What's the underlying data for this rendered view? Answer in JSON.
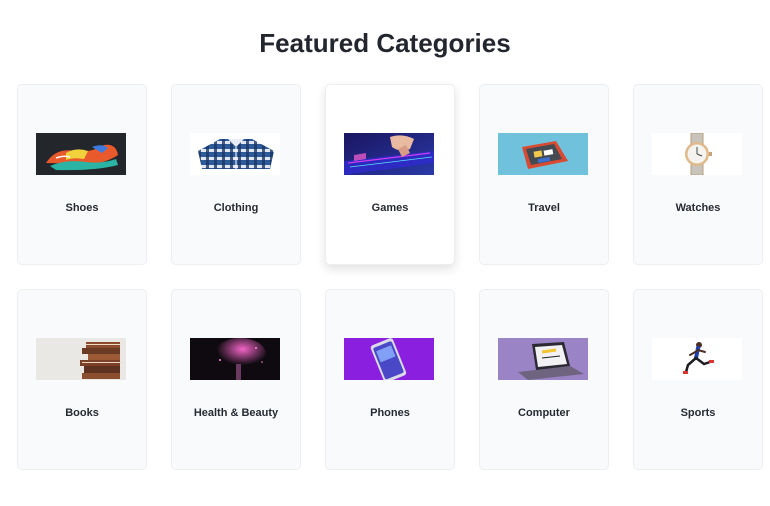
{
  "page": {
    "title": "Featured Categories"
  },
  "categories": [
    {
      "label": "Shoes",
      "icon": "shoes-image"
    },
    {
      "label": "Clothing",
      "icon": "shirt-image"
    },
    {
      "label": "Games",
      "icon": "gaming-keyboard-image"
    },
    {
      "label": "Travel",
      "icon": "suitcase-image"
    },
    {
      "label": "Watches",
      "icon": "watch-image"
    },
    {
      "label": "Books",
      "icon": "books-stack-image"
    },
    {
      "label": "Health & Beauty",
      "icon": "cosmetic-brush-image"
    },
    {
      "label": "Phones",
      "icon": "smartphone-image"
    },
    {
      "label": "Computer",
      "icon": "laptop-image"
    },
    {
      "label": "Sports",
      "icon": "runner-image"
    }
  ],
  "colors": {
    "card_bg": "#f9fafb",
    "card_border": "#eceef2",
    "title": "#23262f"
  }
}
